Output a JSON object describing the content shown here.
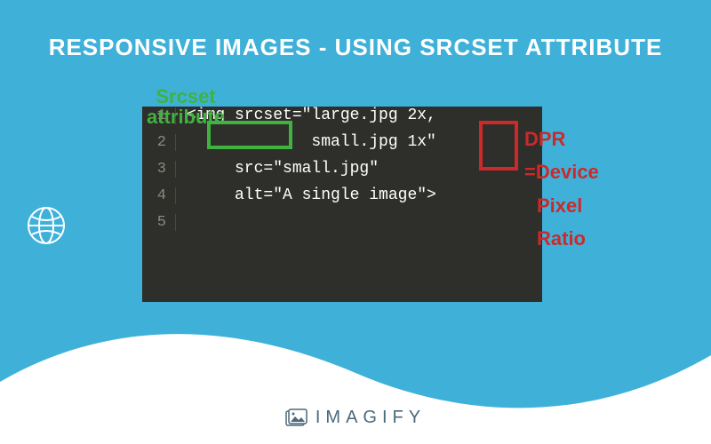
{
  "title": "RESPONSIVE IMAGES - USING SRCSET ATTRIBUTE",
  "code": {
    "lines": [
      "1",
      "2",
      "3",
      "4",
      "5"
    ],
    "content": [
      "<img srcset=\"large.jpg 2x,",
      "             small.jpg 1x\"",
      "     src=\"small.jpg\"",
      "     alt=\"A single image\">",
      " "
    ]
  },
  "annotations": {
    "srcset": {
      "line1": "Srcset",
      "line2": "attribute"
    },
    "dpr": {
      "line1": "DPR",
      "line2": "=Device",
      "line3": "Pixel",
      "line4": "Ratio"
    }
  },
  "brand": "IMAGIFY",
  "colors": {
    "bg": "#3fb1d9",
    "editor": "#2e2e2a",
    "green": "#3fb33f",
    "red": "#cc2a2a",
    "white": "#ffffff"
  }
}
